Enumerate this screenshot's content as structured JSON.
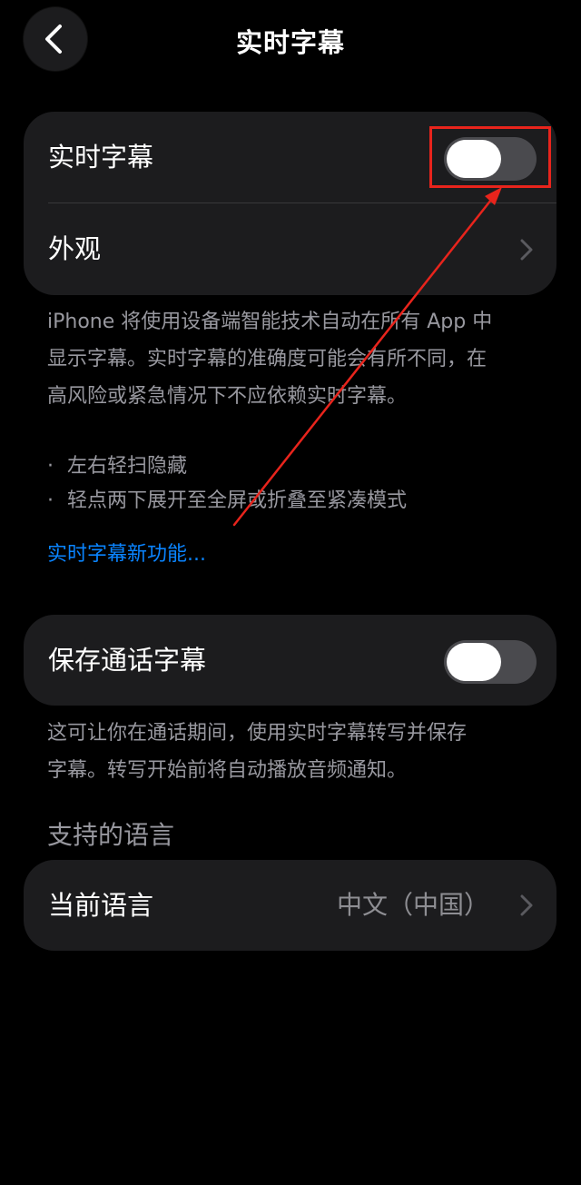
{
  "nav": {
    "title": "实时字幕",
    "back_icon": "chevron-left-icon"
  },
  "card1": {
    "live_captions_label": "实时字幕",
    "live_captions_enabled": false,
    "appearance_label": "外观",
    "appearance_icon": "chevron-right-icon"
  },
  "description": {
    "lines": [
      "iPhone 将使用设备端智能技术自动在所有 App 中",
      "显示字幕。实时字幕的准确度可能会有所不同，在",
      "高风险或紧急情况下不应依赖实时字幕。"
    ],
    "bullet_char": "·",
    "bullets": [
      "左右轻扫隐藏",
      "轻点两下展开至全屏或折叠至紧凑模式"
    ],
    "link": "实时字幕新功能..."
  },
  "card2": {
    "save_call_captions_label": "保存通话字幕",
    "save_call_captions_enabled": false
  },
  "call_description": {
    "lines": [
      "这可让你在通话期间，使用实时字幕转写并保存",
      "字幕。转写开始前将自动播放音频通知。"
    ]
  },
  "languages": {
    "header": "支持的语言",
    "current_label": "当前语言",
    "current_value": "中文（中国）"
  },
  "colors": {
    "background": "#000000",
    "card": "#1c1c1e",
    "secondary_text": "#98989f",
    "link": "#0a84ff",
    "annotation": "#e8241c",
    "toggle_off": "#4a4a4e"
  }
}
